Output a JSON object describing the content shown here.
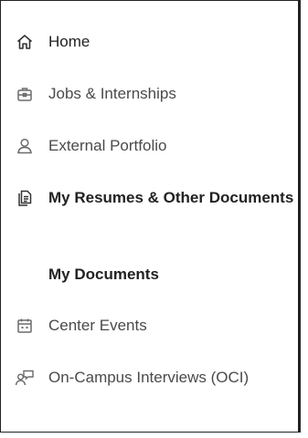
{
  "nav": {
    "items": [
      {
        "label": "Home",
        "icon": "home-icon"
      },
      {
        "label": "Jobs & Internships",
        "icon": "briefcase-icon"
      },
      {
        "label": "External Portfolio",
        "icon": "user-icon"
      },
      {
        "label": "My Resumes & Other Documents",
        "icon": "documents-icon"
      },
      {
        "label": "My Documents",
        "icon": null
      },
      {
        "label": "Center Events",
        "icon": "calendar-icon"
      },
      {
        "label": "On-Campus Interviews (OCI)",
        "icon": "interview-icon"
      }
    ]
  },
  "colors": {
    "text": "#4a4a4a",
    "active": "#222222",
    "icon": "#6b6b6b"
  }
}
